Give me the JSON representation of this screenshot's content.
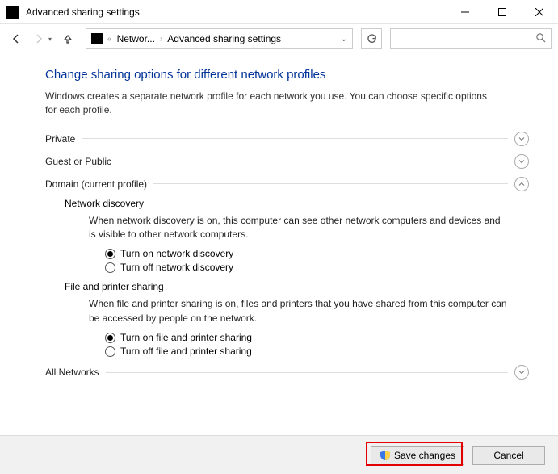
{
  "titlebar": {
    "title": "Advanced sharing settings"
  },
  "breadcrumb": {
    "part1": "Networ...",
    "part2": "Advanced sharing settings"
  },
  "search": {
    "placeholder": ""
  },
  "main": {
    "heading": "Change sharing options for different network profiles",
    "subtext": "Windows creates a separate network profile for each network you use. You can choose specific options for each profile."
  },
  "sections": {
    "private": {
      "label": "Private"
    },
    "guest": {
      "label": "Guest or Public"
    },
    "domain": {
      "label": "Domain (current profile)",
      "network_discovery": {
        "label": "Network discovery",
        "desc": "When network discovery is on, this computer can see other network computers and devices and is visible to other network computers.",
        "opt_on": "Turn on network discovery",
        "opt_off": "Turn off network discovery"
      },
      "file_printer": {
        "label": "File and printer sharing",
        "desc": "When file and printer sharing is on, files and printers that you have shared from this computer can be accessed by people on the network.",
        "opt_on": "Turn on file and printer sharing",
        "opt_off": "Turn off file and printer sharing"
      }
    },
    "all": {
      "label": "All Networks"
    }
  },
  "footer": {
    "save": "Save changes",
    "cancel": "Cancel"
  }
}
